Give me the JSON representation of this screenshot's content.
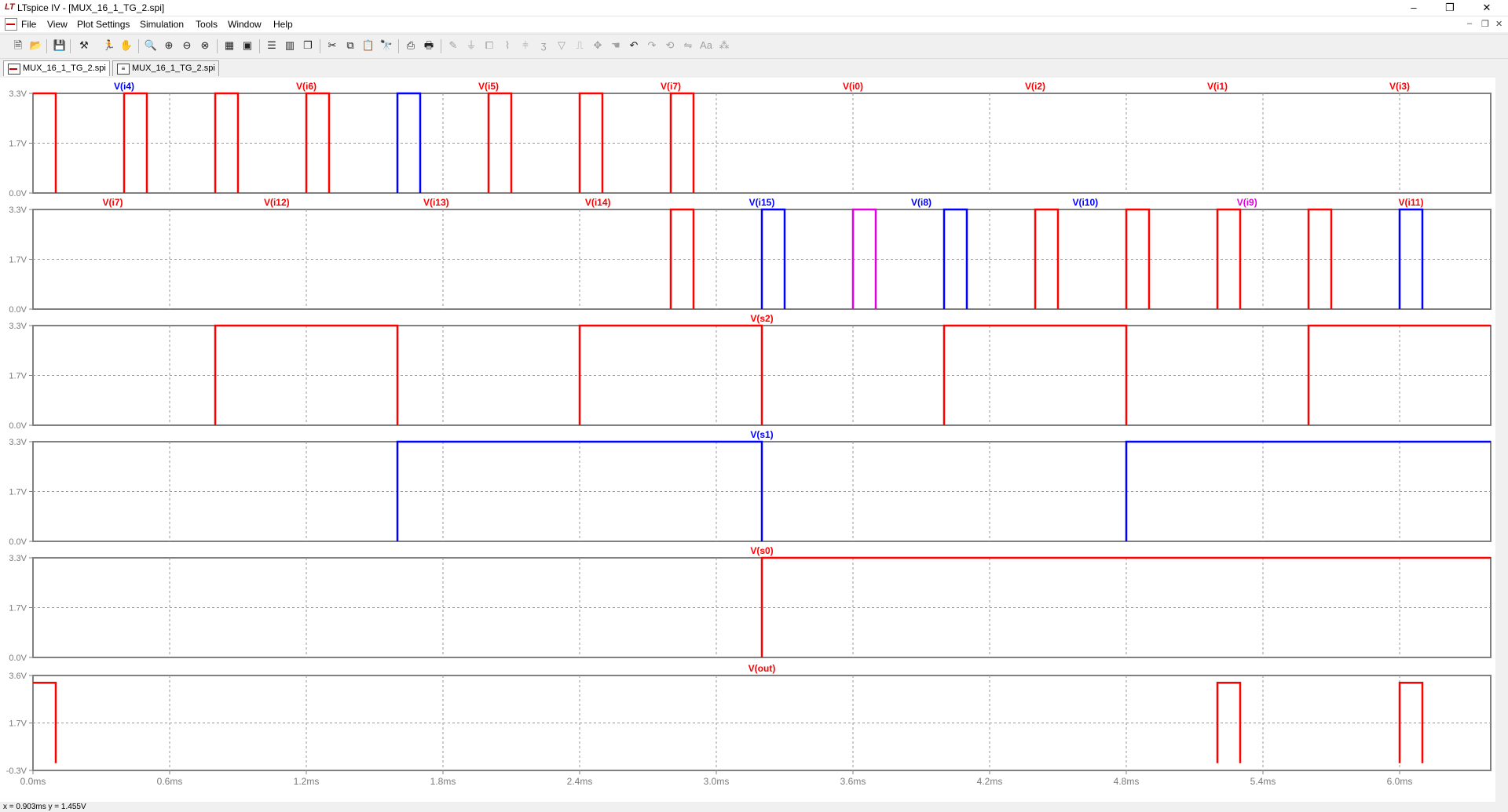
{
  "window": {
    "title": "LTspice IV - [MUX_16_1_TG_2.spi]",
    "minimize": "–",
    "maximize": "❐",
    "close": "✕"
  },
  "menu": [
    "File",
    "View",
    "Plot Settings",
    "Simulation",
    "Tools",
    "Window",
    "Help"
  ],
  "mdi_controls": {
    "minimize": "–",
    "restore": "❐",
    "close": "✕"
  },
  "toolbar_icons": [
    "schematic-icon",
    "open-icon",
    "save-icon",
    "control-panel-icon",
    "run-icon",
    "halt-icon",
    "zoom-in-icon",
    "zoom-box-icon",
    "zoom-out-icon",
    "zoom-full-icon",
    "autorange-icon",
    "autoscale-icon",
    "tile-horizontal-icon",
    "tile-vertical-icon",
    "cascade-icon",
    "cut-icon",
    "copy-icon",
    "paste-icon",
    "find-icon",
    "print-preview-icon",
    "print-icon",
    "wire-icon",
    "ground-icon",
    "label-icon",
    "resistor-icon",
    "capacitor-icon",
    "inductor-icon",
    "diode-icon",
    "component-icon",
    "move-icon",
    "drag-icon",
    "undo-icon",
    "redo-icon",
    "rotate-icon",
    "mirror-icon",
    "text-icon",
    "spice-directive-icon"
  ],
  "tabs": [
    {
      "label": "MUX_16_1_TG_2.spi",
      "icon": "waveform-icon",
      "active": true
    },
    {
      "label": "MUX_16_1_TG_2.spi",
      "icon": "netlist-icon",
      "active": false
    }
  ],
  "status": {
    "text": "x = 0.903ms   y = 1.455V"
  },
  "colors": {
    "red": "#ff0000",
    "blue": "#0000ff",
    "magenta": "#e000e0",
    "grid": "#808080",
    "background": "#ffffff"
  },
  "chart_data": [
    {
      "type": "line",
      "x_ticks": [
        "0.0ms",
        "0.6ms",
        "1.2ms",
        "1.8ms",
        "2.4ms",
        "3.0ms",
        "3.6ms",
        "4.2ms",
        "4.8ms",
        "5.4ms",
        "6.0ms"
      ],
      "xlim": [
        0,
        6.4
      ],
      "ylim": [
        0,
        3.3
      ],
      "y_ticks": [
        "3.3V",
        "1.7V",
        "0.0V"
      ],
      "labels": [
        {
          "name": "V(i4)",
          "x": 0.4,
          "color": "#0000ff"
        },
        {
          "name": "V(i6)",
          "x": 1.2,
          "color": "#ff0000"
        },
        {
          "name": "V(i5)",
          "x": 2.0,
          "color": "#ff0000"
        },
        {
          "name": "V(i7)",
          "x": 2.8,
          "color": "#ff0000"
        },
        {
          "name": "V(i0)",
          "x": 3.6,
          "color": "#ff0000"
        },
        {
          "name": "V(i2)",
          "x": 4.4,
          "color": "#ff0000"
        },
        {
          "name": "V(i1)",
          "x": 5.2,
          "color": "#ff0000"
        },
        {
          "name": "V(i3)",
          "x": 6.0,
          "color": "#ff0000"
        }
      ],
      "series": [
        {
          "color": "#ff0000",
          "pulses": [
            [
              0.0,
              0.1
            ],
            [
              0.4,
              0.5
            ],
            [
              0.8,
              0.9
            ],
            [
              1.2,
              1.3
            ],
            [
              2.0,
              2.1
            ],
            [
              2.4,
              2.5
            ],
            [
              2.8,
              2.9
            ]
          ]
        },
        {
          "color": "#0000ff",
          "pulses": [
            [
              1.6,
              1.7
            ]
          ]
        }
      ]
    },
    {
      "type": "line",
      "x_ticks": [
        "0.0ms",
        "0.6ms",
        "1.2ms",
        "1.8ms",
        "2.4ms",
        "3.0ms",
        "3.6ms",
        "4.2ms",
        "4.8ms",
        "5.4ms",
        "6.0ms"
      ],
      "xlim": [
        0,
        6.4
      ],
      "ylim": [
        0,
        3.3
      ],
      "y_ticks": [
        "3.3V",
        "1.7V",
        "0.0V"
      ],
      "labels": [
        {
          "name": "V(i7)",
          "x": 0.35,
          "color": "#ff0000"
        },
        {
          "name": "V(i12)",
          "x": 1.07,
          "color": "#ff0000"
        },
        {
          "name": "V(i13)",
          "x": 1.77,
          "color": "#ff0000"
        },
        {
          "name": "V(i14)",
          "x": 2.48,
          "color": "#ff0000"
        },
        {
          "name": "V(i15)",
          "x": 3.2,
          "color": "#0000ff"
        },
        {
          "name": "V(i8)",
          "x": 3.9,
          "color": "#0000ff"
        },
        {
          "name": "V(i10)",
          "x": 4.62,
          "color": "#0000ff"
        },
        {
          "name": "V(i9)",
          "x": 5.33,
          "color": "#e000e0"
        },
        {
          "name": "V(i11)",
          "x": 6.05,
          "color": "#ff0000"
        }
      ],
      "series": [
        {
          "color": "#ff0000",
          "pulses": [
            [
              2.8,
              2.9
            ],
            [
              4.4,
              4.5
            ],
            [
              4.8,
              4.9
            ],
            [
              5.2,
              5.3
            ],
            [
              5.6,
              5.7
            ]
          ]
        },
        {
          "color": "#0000ff",
          "pulses": [
            [
              3.2,
              3.3
            ],
            [
              4.0,
              4.1
            ],
            [
              6.0,
              6.1
            ]
          ]
        },
        {
          "color": "#e000e0",
          "pulses": [
            [
              3.6,
              3.7
            ]
          ]
        }
      ]
    },
    {
      "type": "line",
      "x_ticks": [
        "0.0ms",
        "0.6ms",
        "1.2ms",
        "1.8ms",
        "2.4ms",
        "3.0ms",
        "3.6ms",
        "4.2ms",
        "4.8ms",
        "5.4ms",
        "6.0ms"
      ],
      "xlim": [
        0,
        6.4
      ],
      "ylim": [
        0,
        3.3
      ],
      "y_ticks": [
        "3.3V",
        "1.7V",
        "0.0V"
      ],
      "labels": [
        {
          "name": "V(s2)",
          "x": 3.2,
          "color": "#ff0000"
        }
      ],
      "series": [
        {
          "color": "#ff0000",
          "pulses": [
            [
              0.8,
              1.6
            ],
            [
              2.4,
              3.2
            ],
            [
              4.0,
              4.8
            ],
            [
              5.6,
              6.4
            ]
          ]
        }
      ]
    },
    {
      "type": "line",
      "x_ticks": [
        "0.0ms",
        "0.6ms",
        "1.2ms",
        "1.8ms",
        "2.4ms",
        "3.0ms",
        "3.6ms",
        "4.2ms",
        "4.8ms",
        "5.4ms",
        "6.0ms"
      ],
      "xlim": [
        0,
        6.4
      ],
      "ylim": [
        0,
        3.3
      ],
      "y_ticks": [
        "3.3V",
        "1.7V",
        "0.0V"
      ],
      "labels": [
        {
          "name": "V(s1)",
          "x": 3.2,
          "color": "#0000ff"
        }
      ],
      "series": [
        {
          "color": "#0000ff",
          "pulses": [
            [
              1.6,
              3.2
            ],
            [
              4.8,
              6.4
            ]
          ]
        }
      ]
    },
    {
      "type": "line",
      "x_ticks": [
        "0.0ms",
        "0.6ms",
        "1.2ms",
        "1.8ms",
        "2.4ms",
        "3.0ms",
        "3.6ms",
        "4.2ms",
        "4.8ms",
        "5.4ms",
        "6.0ms"
      ],
      "xlim": [
        0,
        6.4
      ],
      "ylim": [
        0,
        3.3
      ],
      "y_ticks": [
        "3.3V",
        "1.7V",
        "0.0V"
      ],
      "labels": [
        {
          "name": "V(s0)",
          "x": 3.2,
          "color": "#ff0000"
        }
      ],
      "series": [
        {
          "color": "#ff0000",
          "pulses": [
            [
              3.2,
              6.4
            ]
          ]
        }
      ]
    },
    {
      "type": "line",
      "x_ticks": [
        "0.0ms",
        "0.6ms",
        "1.2ms",
        "1.8ms",
        "2.4ms",
        "3.0ms",
        "3.6ms",
        "4.2ms",
        "4.8ms",
        "5.4ms",
        "6.0ms"
      ],
      "xlim": [
        0,
        6.4
      ],
      "ylim": [
        -0.3,
        3.6
      ],
      "y_ticks": [
        "3.6V",
        "1.7V",
        "-0.3V"
      ],
      "high_value": 3.3,
      "low_value": 0,
      "labels": [
        {
          "name": "V(out)",
          "x": 3.2,
          "color": "#ff0000"
        }
      ],
      "series": [
        {
          "color": "#ff0000",
          "pulses": [
            [
              0.0,
              0.1
            ],
            [
              5.2,
              5.3
            ],
            [
              6.0,
              6.1
            ]
          ]
        }
      ]
    }
  ]
}
